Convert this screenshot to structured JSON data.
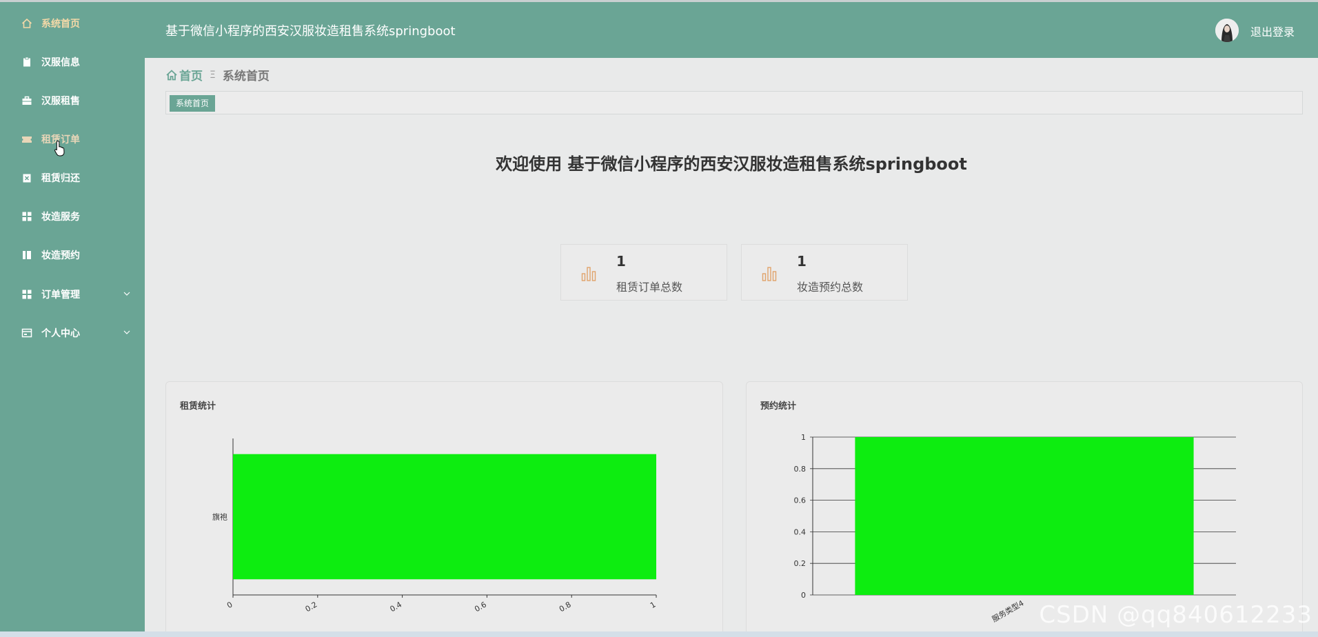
{
  "sidebar": {
    "items": [
      {
        "label": "系统首页",
        "icon": "home-icon"
      },
      {
        "label": "汉服信息",
        "icon": "clipboard-icon"
      },
      {
        "label": "汉服租售",
        "icon": "briefcase-icon"
      },
      {
        "label": "租赁订单",
        "icon": "ticket-icon"
      },
      {
        "label": "租赁归还",
        "icon": "clipboard-x-icon"
      },
      {
        "label": "妆造服务",
        "icon": "grid-icon"
      },
      {
        "label": "妆造预约",
        "icon": "book-icon"
      },
      {
        "label": "订单管理",
        "icon": "grid-icon"
      },
      {
        "label": "个人中心",
        "icon": "card-icon"
      }
    ]
  },
  "header": {
    "title": "基于微信小程序的西安汉服妆造租售系统springboot",
    "logout": "退出登录"
  },
  "breadcrumb": {
    "home": "首页",
    "separator": "Ξ",
    "current": "系统首页"
  },
  "tags": {
    "active": "系统首页"
  },
  "welcome": "欢迎使用 基于微信小程序的西安汉服妆造租售系统springboot",
  "stats": [
    {
      "value": "1",
      "label": "租赁订单总数"
    },
    {
      "value": "1",
      "label": "妆造预约总数"
    }
  ],
  "chart_data": [
    {
      "type": "bar",
      "orientation": "horizontal",
      "title": "租赁统计",
      "categories": [
        "旗袍"
      ],
      "values": [
        1
      ],
      "xlim": [
        0,
        1
      ],
      "xticks": [
        "0",
        "0.2",
        "0.4",
        "0.6",
        "0.8",
        "1"
      ],
      "color": "#0ded10"
    },
    {
      "type": "bar",
      "orientation": "vertical",
      "title": "预约统计",
      "categories": [
        "服务类型4"
      ],
      "values": [
        1
      ],
      "ylim": [
        0,
        1
      ],
      "yticks": [
        "0",
        "0.2",
        "0.4",
        "0.6",
        "0.8",
        "1"
      ],
      "grid": true,
      "color": "#0ded10"
    }
  ],
  "watermark": "CSDN @qq840612233",
  "colors": {
    "theme": "#6aa595",
    "active_menu": "#f4d9a8",
    "bar": "#0ded10",
    "stat_icon": "#e0a36a"
  }
}
